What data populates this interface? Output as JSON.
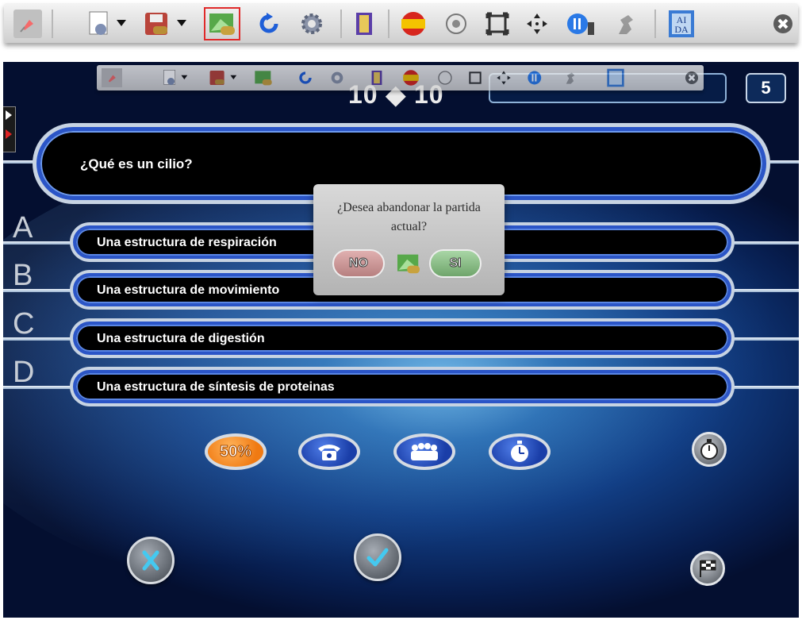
{
  "toolbar": {
    "icons": [
      "pin-icon",
      "settings-menu-icon",
      "save-menu-icon",
      "new-game-icon",
      "reset-icon",
      "options-gear-icon",
      "info-book-icon",
      "language-spain-icon",
      "sound-icon",
      "fullscreen-icon",
      "move-icon",
      "pause-icon",
      "speed-icon",
      "help-aida-icon",
      "close-icon"
    ],
    "aida_label": "AIDA"
  },
  "game": {
    "counter": "10 ◆ 10",
    "score": "5",
    "question": "¿Qué es un cilio?",
    "answers": [
      {
        "letter": "A",
        "text": "Una estructura de respiración"
      },
      {
        "letter": "B",
        "text": "Una estructura de movimiento"
      },
      {
        "letter": "C",
        "text": "Una estructura de digestión"
      },
      {
        "letter": "D",
        "text": "Una estructura de síntesis de proteinas"
      }
    ],
    "lifelines": {
      "fifty": "50%"
    }
  },
  "dialog": {
    "message": "¿Desea abandonar la partida actual?",
    "no_label": "NO",
    "yes_label": "SI"
  },
  "colors": {
    "accent_blue": "#2b55c7",
    "fifty_orange": "#f07a12",
    "check_cyan": "#4fc7e8"
  }
}
